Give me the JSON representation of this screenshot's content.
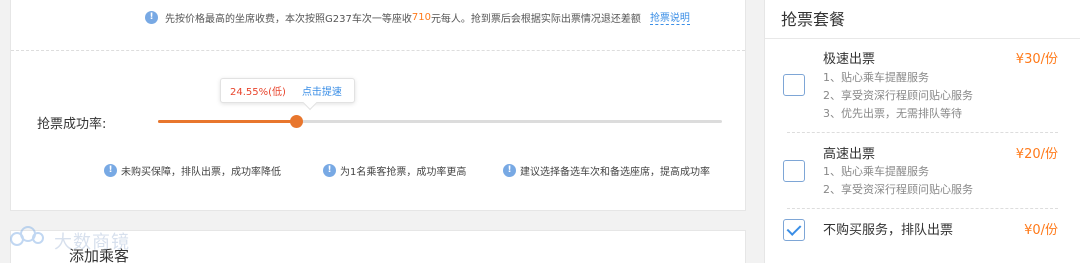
{
  "notice": {
    "text_prefix": "先按价格最高的坐席收费，本次按照G237车次一等座收",
    "price": "710",
    "text_suffix": "元每人。抢到票后会根据实际出票情况退还差额",
    "link": "抢票说明"
  },
  "rate": {
    "label": "抢票成功率:",
    "percent_value": 24.55,
    "tooltip_text": "24.55%(低)",
    "tooltip_action": "点击提速",
    "accent_color": "#e8762d"
  },
  "tips": [
    {
      "icon": "info-icon",
      "text": "未购买保障，排队出票，成功率降低"
    },
    {
      "icon": "info-icon",
      "text": "为1名乘客抢票，成功率更高"
    },
    {
      "icon": "info-icon",
      "text": "建议选择备选车次和备选座席，提高成功率"
    }
  ],
  "passengers": {
    "title": "添加乘客",
    "watermark": "大数商镜"
  },
  "packages": {
    "title": "抢票套餐",
    "items": [
      {
        "name": "极速出票",
        "price": "¥30/份",
        "checked": false,
        "features": [
          "1、贴心乘车提醒服务",
          "2、享受资深行程顾问贴心服务",
          "3、优先出票，无需排队等待"
        ]
      },
      {
        "name": "高速出票",
        "price": "¥20/份",
        "checked": false,
        "features": [
          "1、贴心乘车提醒服务",
          "2、享受资深行程顾问贴心服务"
        ]
      },
      {
        "name": "不购买服务，排队出票",
        "price": "¥0/份",
        "checked": true,
        "features": []
      }
    ]
  }
}
